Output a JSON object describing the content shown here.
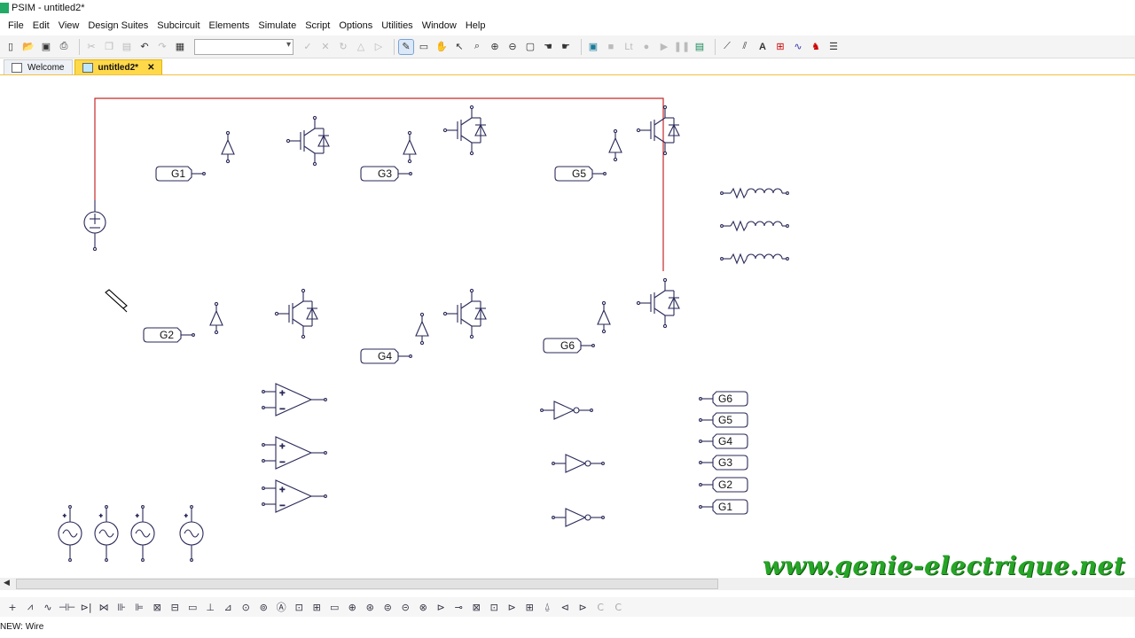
{
  "window": {
    "title": "PSIM - untitled2*"
  },
  "menu": [
    "File",
    "Edit",
    "View",
    "Design Suites",
    "Subcircuit",
    "Elements",
    "Simulate",
    "Script",
    "Options",
    "Utilities",
    "Window",
    "Help"
  ],
  "toolbar": {
    "icons": [
      "new-icon",
      "open-icon",
      "save-icon",
      "print-icon",
      "cut-icon",
      "copy-icon",
      "paste-icon",
      "undo-icon",
      "redo-icon",
      "clipboard-icon"
    ],
    "combo_value": "",
    "right_icons": [
      "check-icon",
      "x-icon",
      "rotate-icon",
      "flip-icon",
      "mirror-icon",
      "wire-icon",
      "label-icon",
      "pan-icon",
      "select-icon",
      "zoom-icon",
      "zoom-in-icon",
      "zoom-out-icon",
      "fit-icon",
      "hand-icon",
      "stop-hand-icon",
      "run-icon",
      "grey-icon",
      "lt-icon",
      "circle-icon",
      "play-icon",
      "pause-icon",
      "scope-icon",
      "probe-icon",
      "text-icon",
      "ammeter-icon",
      "wave-icon",
      "animal-icon",
      "list-icon"
    ],
    "lt_label": "Lt",
    "text_label": "A"
  },
  "tabs": [
    {
      "label": "Welcome",
      "active": false
    },
    {
      "label": "untitled2*",
      "active": true,
      "close": "✕"
    }
  ],
  "labels": {
    "g1": "G1",
    "g2": "G2",
    "g3": "G3",
    "g4": "G4",
    "g5": "G5",
    "g6": "G6",
    "out_g6": "G6",
    "out_g5": "G5",
    "out_g4": "G4",
    "out_g3": "G3",
    "out_g2": "G2",
    "out_g1": "G1"
  },
  "status": {
    "text": "NEW: Wire"
  },
  "watermark": "www.genie-electrique.net",
  "colors": {
    "wire": "#c62828",
    "component": "#2a2a5a",
    "tab_active": "#ffd94a",
    "watermark": "#26a526"
  }
}
